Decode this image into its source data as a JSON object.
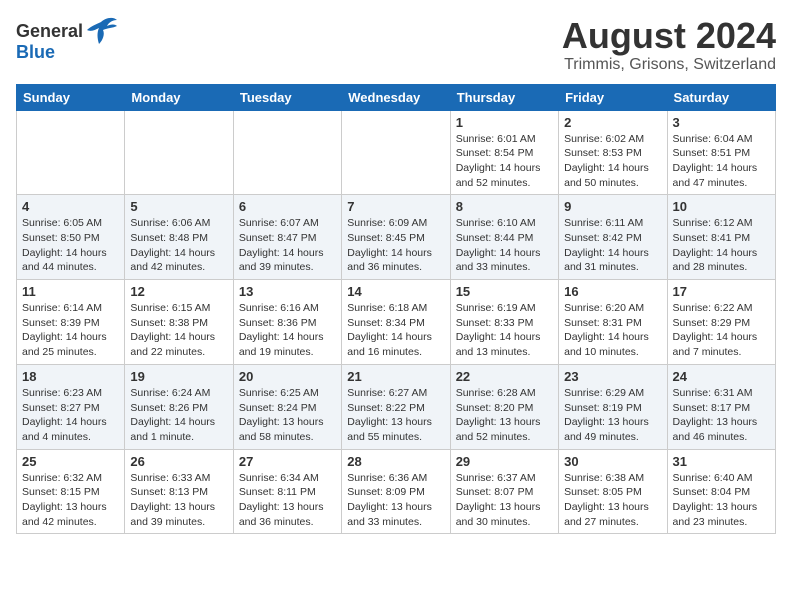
{
  "header": {
    "logo_general": "General",
    "logo_blue": "Blue",
    "title": "August 2024",
    "subtitle": "Trimmis, Grisons, Switzerland"
  },
  "weekdays": [
    "Sunday",
    "Monday",
    "Tuesday",
    "Wednesday",
    "Thursday",
    "Friday",
    "Saturday"
  ],
  "weeks": [
    [
      {
        "day": "",
        "sunrise": "",
        "sunset": "",
        "daylight": ""
      },
      {
        "day": "",
        "sunrise": "",
        "sunset": "",
        "daylight": ""
      },
      {
        "day": "",
        "sunrise": "",
        "sunset": "",
        "daylight": ""
      },
      {
        "day": "",
        "sunrise": "",
        "sunset": "",
        "daylight": ""
      },
      {
        "day": "1",
        "sunrise": "Sunrise: 6:01 AM",
        "sunset": "Sunset: 8:54 PM",
        "daylight": "Daylight: 14 hours and 52 minutes."
      },
      {
        "day": "2",
        "sunrise": "Sunrise: 6:02 AM",
        "sunset": "Sunset: 8:53 PM",
        "daylight": "Daylight: 14 hours and 50 minutes."
      },
      {
        "day": "3",
        "sunrise": "Sunrise: 6:04 AM",
        "sunset": "Sunset: 8:51 PM",
        "daylight": "Daylight: 14 hours and 47 minutes."
      }
    ],
    [
      {
        "day": "4",
        "sunrise": "Sunrise: 6:05 AM",
        "sunset": "Sunset: 8:50 PM",
        "daylight": "Daylight: 14 hours and 44 minutes."
      },
      {
        "day": "5",
        "sunrise": "Sunrise: 6:06 AM",
        "sunset": "Sunset: 8:48 PM",
        "daylight": "Daylight: 14 hours and 42 minutes."
      },
      {
        "day": "6",
        "sunrise": "Sunrise: 6:07 AM",
        "sunset": "Sunset: 8:47 PM",
        "daylight": "Daylight: 14 hours and 39 minutes."
      },
      {
        "day": "7",
        "sunrise": "Sunrise: 6:09 AM",
        "sunset": "Sunset: 8:45 PM",
        "daylight": "Daylight: 14 hours and 36 minutes."
      },
      {
        "day": "8",
        "sunrise": "Sunrise: 6:10 AM",
        "sunset": "Sunset: 8:44 PM",
        "daylight": "Daylight: 14 hours and 33 minutes."
      },
      {
        "day": "9",
        "sunrise": "Sunrise: 6:11 AM",
        "sunset": "Sunset: 8:42 PM",
        "daylight": "Daylight: 14 hours and 31 minutes."
      },
      {
        "day": "10",
        "sunrise": "Sunrise: 6:12 AM",
        "sunset": "Sunset: 8:41 PM",
        "daylight": "Daylight: 14 hours and 28 minutes."
      }
    ],
    [
      {
        "day": "11",
        "sunrise": "Sunrise: 6:14 AM",
        "sunset": "Sunset: 8:39 PM",
        "daylight": "Daylight: 14 hours and 25 minutes."
      },
      {
        "day": "12",
        "sunrise": "Sunrise: 6:15 AM",
        "sunset": "Sunset: 8:38 PM",
        "daylight": "Daylight: 14 hours and 22 minutes."
      },
      {
        "day": "13",
        "sunrise": "Sunrise: 6:16 AM",
        "sunset": "Sunset: 8:36 PM",
        "daylight": "Daylight: 14 hours and 19 minutes."
      },
      {
        "day": "14",
        "sunrise": "Sunrise: 6:18 AM",
        "sunset": "Sunset: 8:34 PM",
        "daylight": "Daylight: 14 hours and 16 minutes."
      },
      {
        "day": "15",
        "sunrise": "Sunrise: 6:19 AM",
        "sunset": "Sunset: 8:33 PM",
        "daylight": "Daylight: 14 hours and 13 minutes."
      },
      {
        "day": "16",
        "sunrise": "Sunrise: 6:20 AM",
        "sunset": "Sunset: 8:31 PM",
        "daylight": "Daylight: 14 hours and 10 minutes."
      },
      {
        "day": "17",
        "sunrise": "Sunrise: 6:22 AM",
        "sunset": "Sunset: 8:29 PM",
        "daylight": "Daylight: 14 hours and 7 minutes."
      }
    ],
    [
      {
        "day": "18",
        "sunrise": "Sunrise: 6:23 AM",
        "sunset": "Sunset: 8:27 PM",
        "daylight": "Daylight: 14 hours and 4 minutes."
      },
      {
        "day": "19",
        "sunrise": "Sunrise: 6:24 AM",
        "sunset": "Sunset: 8:26 PM",
        "daylight": "Daylight: 14 hours and 1 minute."
      },
      {
        "day": "20",
        "sunrise": "Sunrise: 6:25 AM",
        "sunset": "Sunset: 8:24 PM",
        "daylight": "Daylight: 13 hours and 58 minutes."
      },
      {
        "day": "21",
        "sunrise": "Sunrise: 6:27 AM",
        "sunset": "Sunset: 8:22 PM",
        "daylight": "Daylight: 13 hours and 55 minutes."
      },
      {
        "day": "22",
        "sunrise": "Sunrise: 6:28 AM",
        "sunset": "Sunset: 8:20 PM",
        "daylight": "Daylight: 13 hours and 52 minutes."
      },
      {
        "day": "23",
        "sunrise": "Sunrise: 6:29 AM",
        "sunset": "Sunset: 8:19 PM",
        "daylight": "Daylight: 13 hours and 49 minutes."
      },
      {
        "day": "24",
        "sunrise": "Sunrise: 6:31 AM",
        "sunset": "Sunset: 8:17 PM",
        "daylight": "Daylight: 13 hours and 46 minutes."
      }
    ],
    [
      {
        "day": "25",
        "sunrise": "Sunrise: 6:32 AM",
        "sunset": "Sunset: 8:15 PM",
        "daylight": "Daylight: 13 hours and 42 minutes."
      },
      {
        "day": "26",
        "sunrise": "Sunrise: 6:33 AM",
        "sunset": "Sunset: 8:13 PM",
        "daylight": "Daylight: 13 hours and 39 minutes."
      },
      {
        "day": "27",
        "sunrise": "Sunrise: 6:34 AM",
        "sunset": "Sunset: 8:11 PM",
        "daylight": "Daylight: 13 hours and 36 minutes."
      },
      {
        "day": "28",
        "sunrise": "Sunrise: 6:36 AM",
        "sunset": "Sunset: 8:09 PM",
        "daylight": "Daylight: 13 hours and 33 minutes."
      },
      {
        "day": "29",
        "sunrise": "Sunrise: 6:37 AM",
        "sunset": "Sunset: 8:07 PM",
        "daylight": "Daylight: 13 hours and 30 minutes."
      },
      {
        "day": "30",
        "sunrise": "Sunrise: 6:38 AM",
        "sunset": "Sunset: 8:05 PM",
        "daylight": "Daylight: 13 hours and 27 minutes."
      },
      {
        "day": "31",
        "sunrise": "Sunrise: 6:40 AM",
        "sunset": "Sunset: 8:04 PM",
        "daylight": "Daylight: 13 hours and 23 minutes."
      }
    ]
  ]
}
